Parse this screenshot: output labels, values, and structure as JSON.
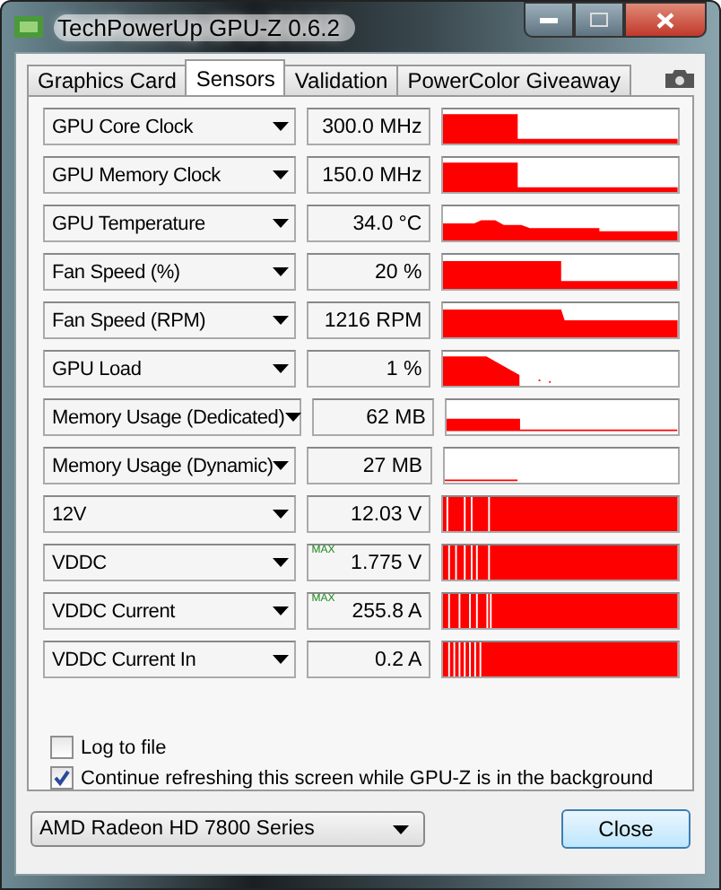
{
  "window": {
    "title": "TechPowerUp GPU-Z 0.6.2"
  },
  "tabs": [
    {
      "label": "Graphics Card",
      "selected": false
    },
    {
      "label": "Sensors",
      "selected": true
    },
    {
      "label": "Validation",
      "selected": false
    },
    {
      "label": "PowerColor Giveaway",
      "selected": false
    }
  ],
  "sensors": [
    {
      "name": "GPU Core Clock",
      "value": "300.0 MHz"
    },
    {
      "name": "GPU Memory Clock",
      "value": "150.0 MHz"
    },
    {
      "name": "GPU Temperature",
      "value": "34.0 °C"
    },
    {
      "name": "Fan Speed (%)",
      "value": "20 %"
    },
    {
      "name": "Fan Speed (RPM)",
      "value": "1216 RPM"
    },
    {
      "name": "GPU Load",
      "value": "1 %"
    },
    {
      "name": "Memory Usage (Dedicated)",
      "value": "62 MB"
    },
    {
      "name": "Memory Usage (Dynamic)",
      "value": "27 MB"
    },
    {
      "name": "12V",
      "value": "12.03 V"
    },
    {
      "name": "VDDC",
      "value": "1.775 V",
      "badge": "MAX"
    },
    {
      "name": "VDDC Current",
      "value": "255.8 A",
      "badge": "MAX"
    },
    {
      "name": "VDDC Current In",
      "value": "0.2 A"
    }
  ],
  "options": [
    {
      "label": "Log to file",
      "checked": false
    },
    {
      "label": "Continue refreshing this screen while GPU-Z is in the background",
      "checked": true
    }
  ],
  "device_select": {
    "value": "AMD Radeon HD 7800 Series"
  },
  "buttons": [
    "Close"
  ]
}
